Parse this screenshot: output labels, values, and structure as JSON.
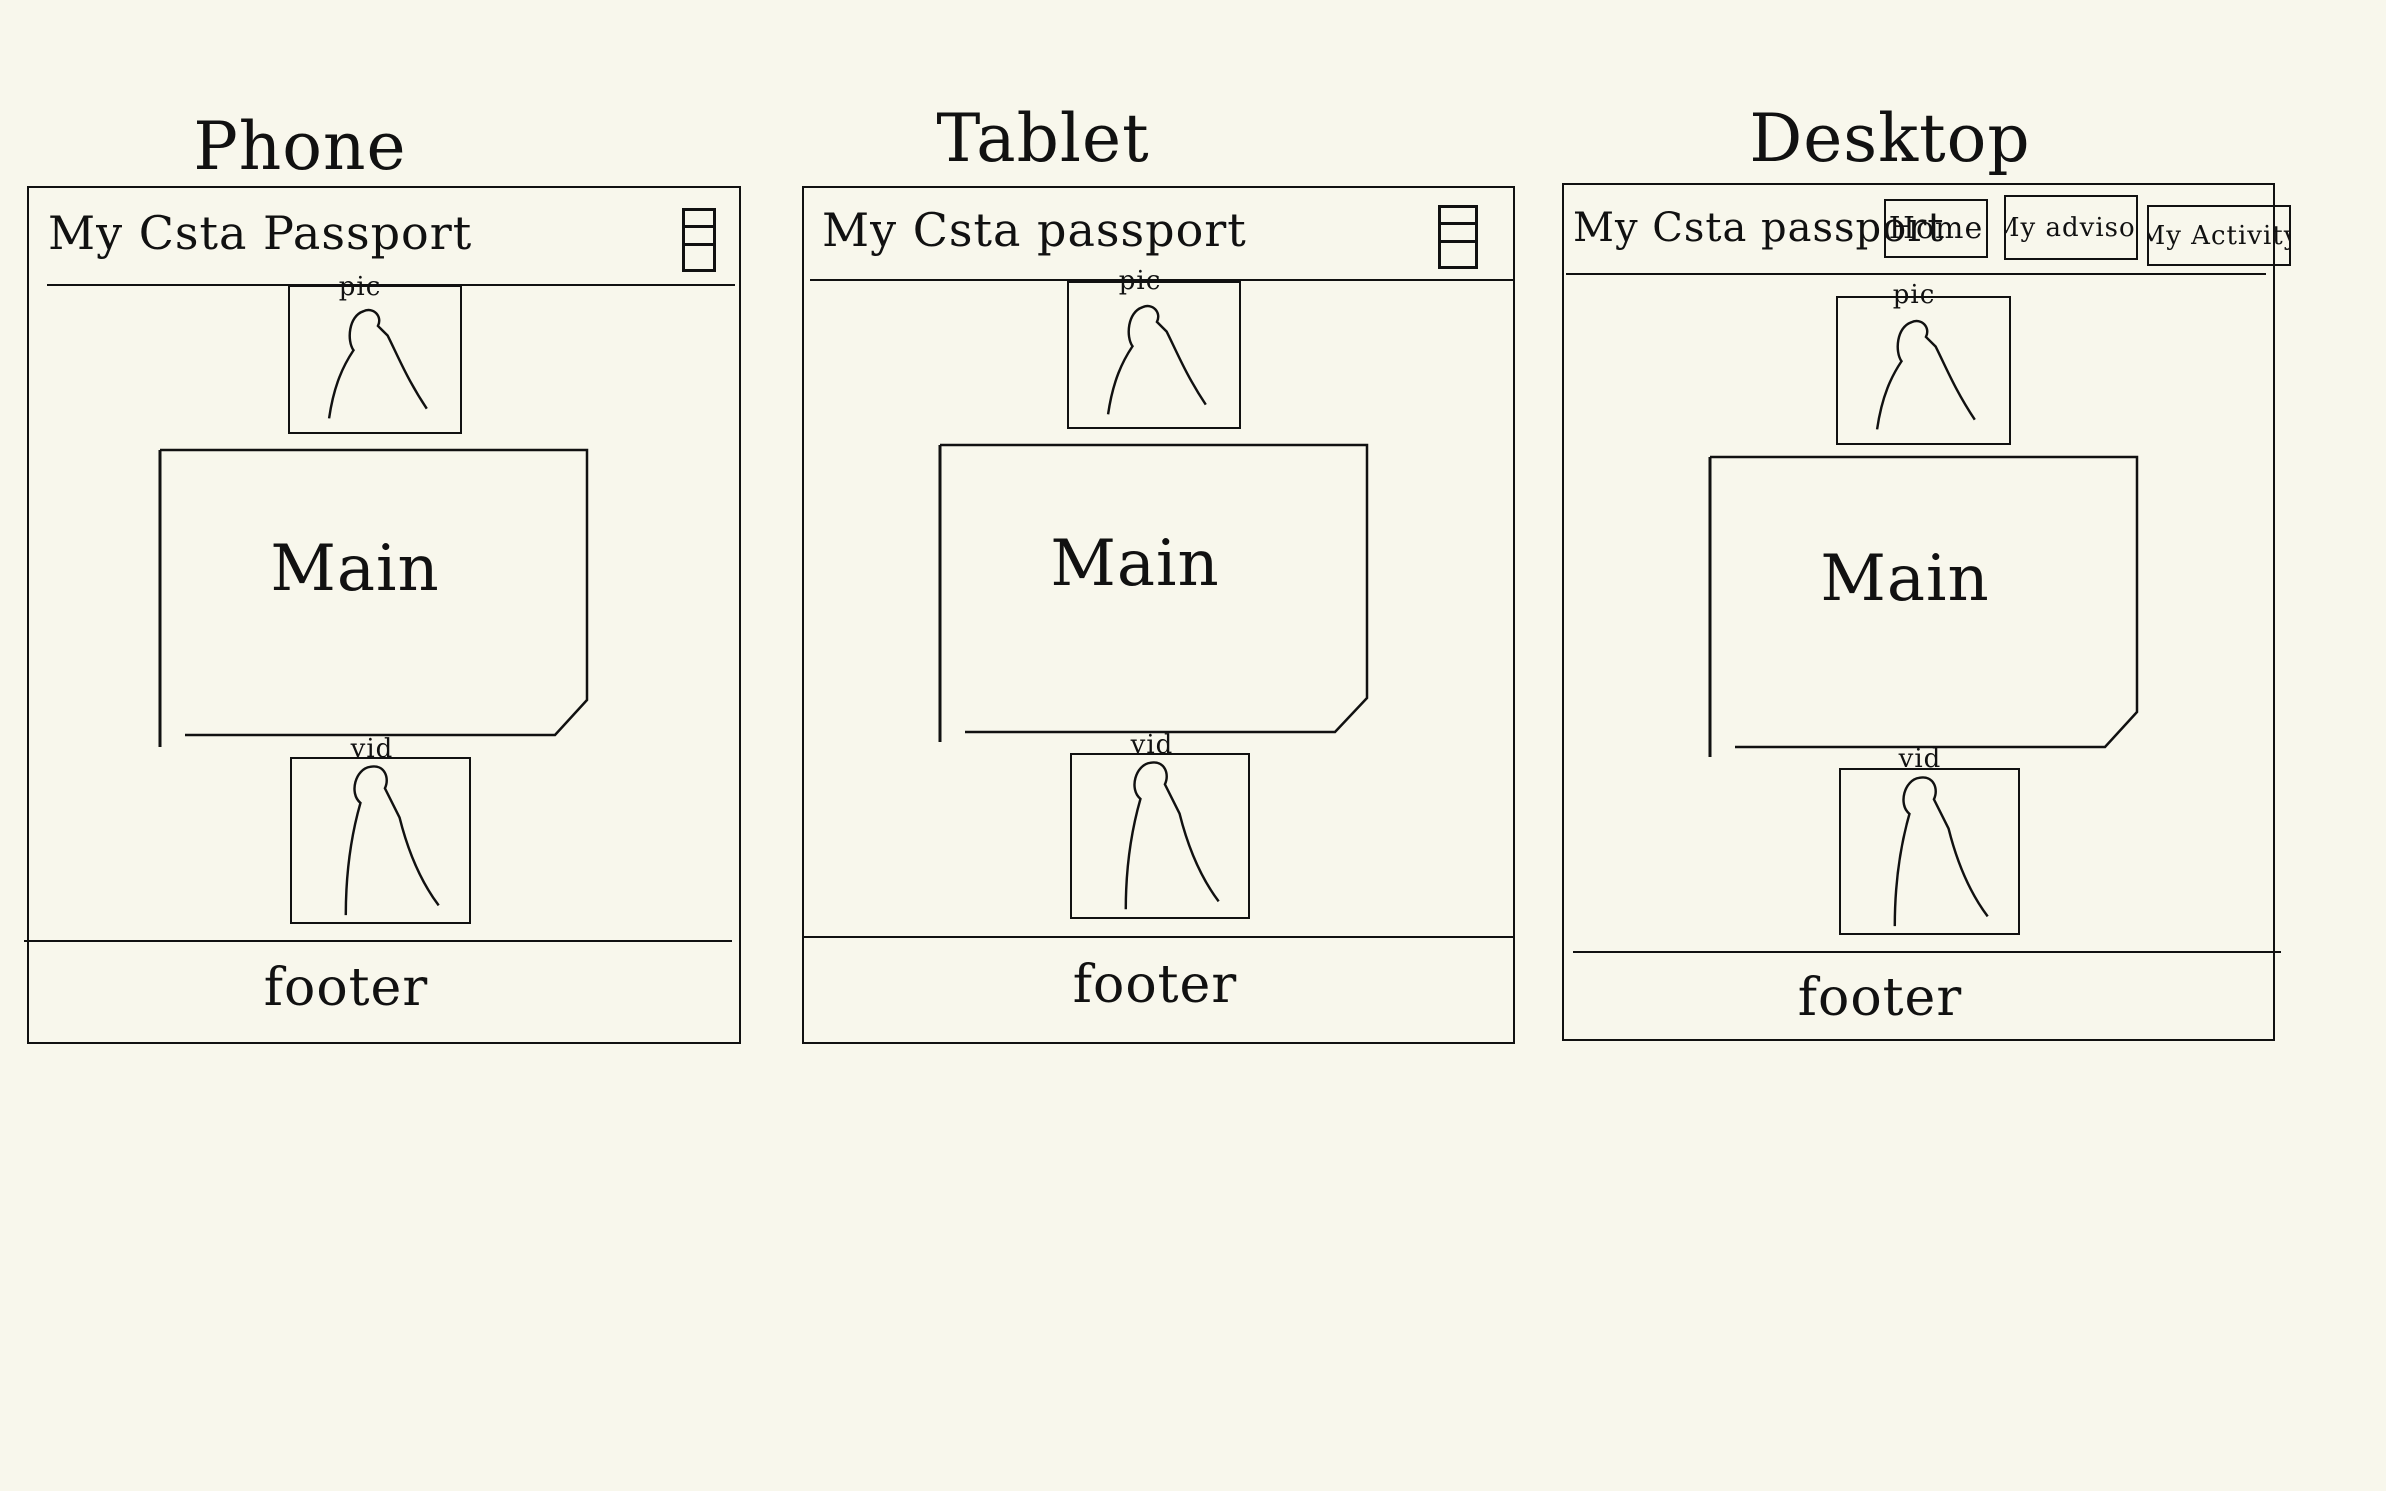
{
  "devices": {
    "phone": {
      "label": "Phone",
      "title": "My Csta Passport",
      "pic": "pic",
      "main": "Main",
      "vid": "vid",
      "footer": "footer"
    },
    "tablet": {
      "label": "Tablet",
      "title": "My Csta passport",
      "pic": "pic",
      "main": "Main",
      "vid": "vid",
      "footer": "footer"
    },
    "desktop": {
      "label": "Desktop",
      "title": "My Csta passport",
      "nav": [
        "Home",
        "My advisor",
        "My Activity"
      ],
      "pic": "pic",
      "main": "Main",
      "vid": "vid",
      "footer": "footer"
    }
  },
  "icons": {
    "menu": "hamburger-menu-icon",
    "person": "person-silhouette-icon"
  },
  "colors": {
    "background": "#f8f7ec",
    "ink": "#111111"
  }
}
